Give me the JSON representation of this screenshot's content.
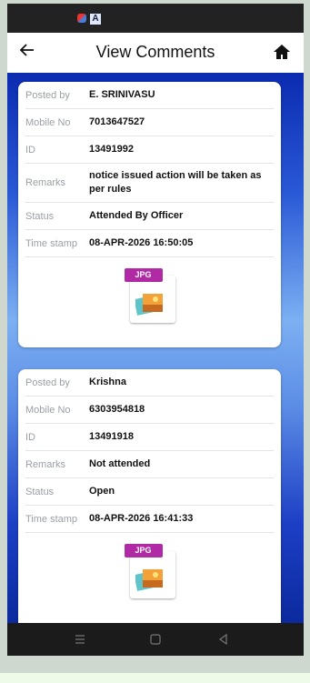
{
  "app": {
    "title": "View Comments"
  },
  "labels": {
    "posted_by": "Posted by",
    "mobile_no": "Mobile No",
    "id": "ID",
    "remarks": "Remarks",
    "status": "Status",
    "time_stamp": "Time stamp"
  },
  "comments": [
    {
      "posted_by": "E. SRINIVASU",
      "mobile_no": "7013647527",
      "id": "13491992",
      "remarks": "notice issued action will be taken as per rules",
      "status": "Attended By Officer",
      "time_stamp": "08-APR-2026 16:50:05",
      "attachment_type": "JPG"
    },
    {
      "posted_by": "Krishna",
      "mobile_no": "6303954818",
      "id": "13491918",
      "remarks": "Not attended",
      "status": "Open",
      "time_stamp": "08-APR-2026 16:41:33",
      "attachment_type": "JPG"
    }
  ],
  "status_bar": {
    "icon_1": "notification-app-icon",
    "icon_2_text": "A"
  },
  "icons": {
    "back": "back-arrow-icon",
    "home": "home-icon",
    "nav_recents": "recents-icon",
    "nav_home": "nav-home-icon",
    "nav_back": "nav-back-icon"
  },
  "colors": {
    "background_top": "#0b2bb0",
    "background_mid": "#7cb0f2",
    "accent_tag": "#b02aa6",
    "card": "#ffffff"
  }
}
